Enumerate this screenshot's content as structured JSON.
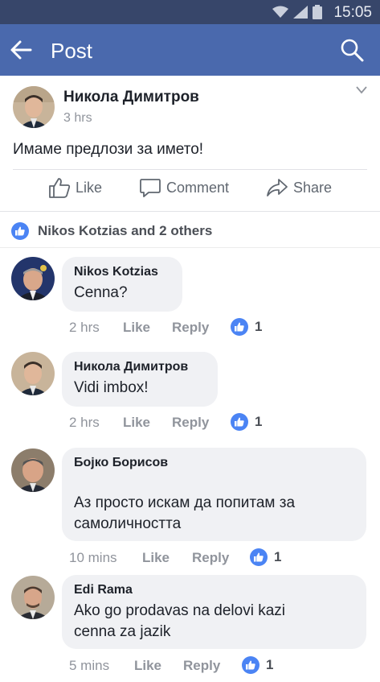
{
  "statusbar": {
    "time": "15:05"
  },
  "appbar": {
    "title": "Post"
  },
  "post": {
    "author": "Никола Димитров",
    "time": "3 hrs",
    "text": "Имаме предлози за името!",
    "actions": {
      "like": "Like",
      "comment": "Comment",
      "share": "Share"
    }
  },
  "reactions": {
    "label": "Nikos Kotzias and 2 others"
  },
  "comments": [
    {
      "name": "Nikos Kotzias",
      "text": "Cenna?",
      "time": "2 hrs",
      "like_label": "Like",
      "reply_label": "Reply",
      "likes": "1"
    },
    {
      "name": "Никола Димитров",
      "text": "Vidi imbox!",
      "time": "2 hrs",
      "like_label": "Like",
      "reply_label": "Reply",
      "likes": "1"
    },
    {
      "name": "Бојко Борисов",
      "text_line1": "Аз просто искам да попитам за",
      "text_line2": "самоличността",
      "time": "10 mins",
      "like_label": "Like",
      "reply_label": "Reply",
      "likes": "1"
    },
    {
      "name": "Edi Rama",
      "text_line1": "Ako go prodavas na delovi kazi",
      "text_line2": "cenna za jazik",
      "time": "5 mins",
      "like_label": "Like",
      "reply_label": "Reply",
      "likes": "1"
    }
  ],
  "colors": {
    "appbar": "#4a69ad",
    "statusbar": "#37466a",
    "like_blue": "#4b84f4",
    "bubble": "#f0f1f4"
  }
}
